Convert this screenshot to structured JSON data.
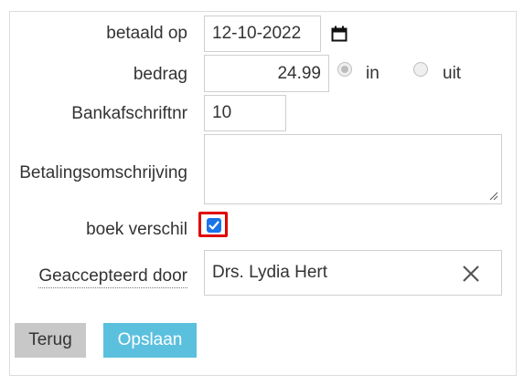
{
  "form": {
    "paid_on": {
      "label": "betaald op",
      "value": "12-10-2022"
    },
    "amount": {
      "label": "bedrag",
      "value": "24.99",
      "direction": {
        "options": [
          "in",
          "uit"
        ],
        "selected": "in"
      }
    },
    "statement_number": {
      "label": "Bankafschriftnr",
      "value": "10"
    },
    "payment_description": {
      "label": "Betalingsomschrijving",
      "value": ""
    },
    "book_difference": {
      "label": "boek verschil",
      "checked": true
    },
    "accepted_by": {
      "label": "Geaccepteerd door",
      "value": "Drs. Lydia Hert"
    }
  },
  "buttons": {
    "back": "Terug",
    "save": "Opslaan"
  },
  "colors": {
    "save_button": "#5bc0de",
    "checkbox_highlight": "#e00000",
    "checkbox": "#1a73e8"
  },
  "icons": [
    "calendar-icon",
    "clear-icon",
    "resize-grip-icon"
  ]
}
